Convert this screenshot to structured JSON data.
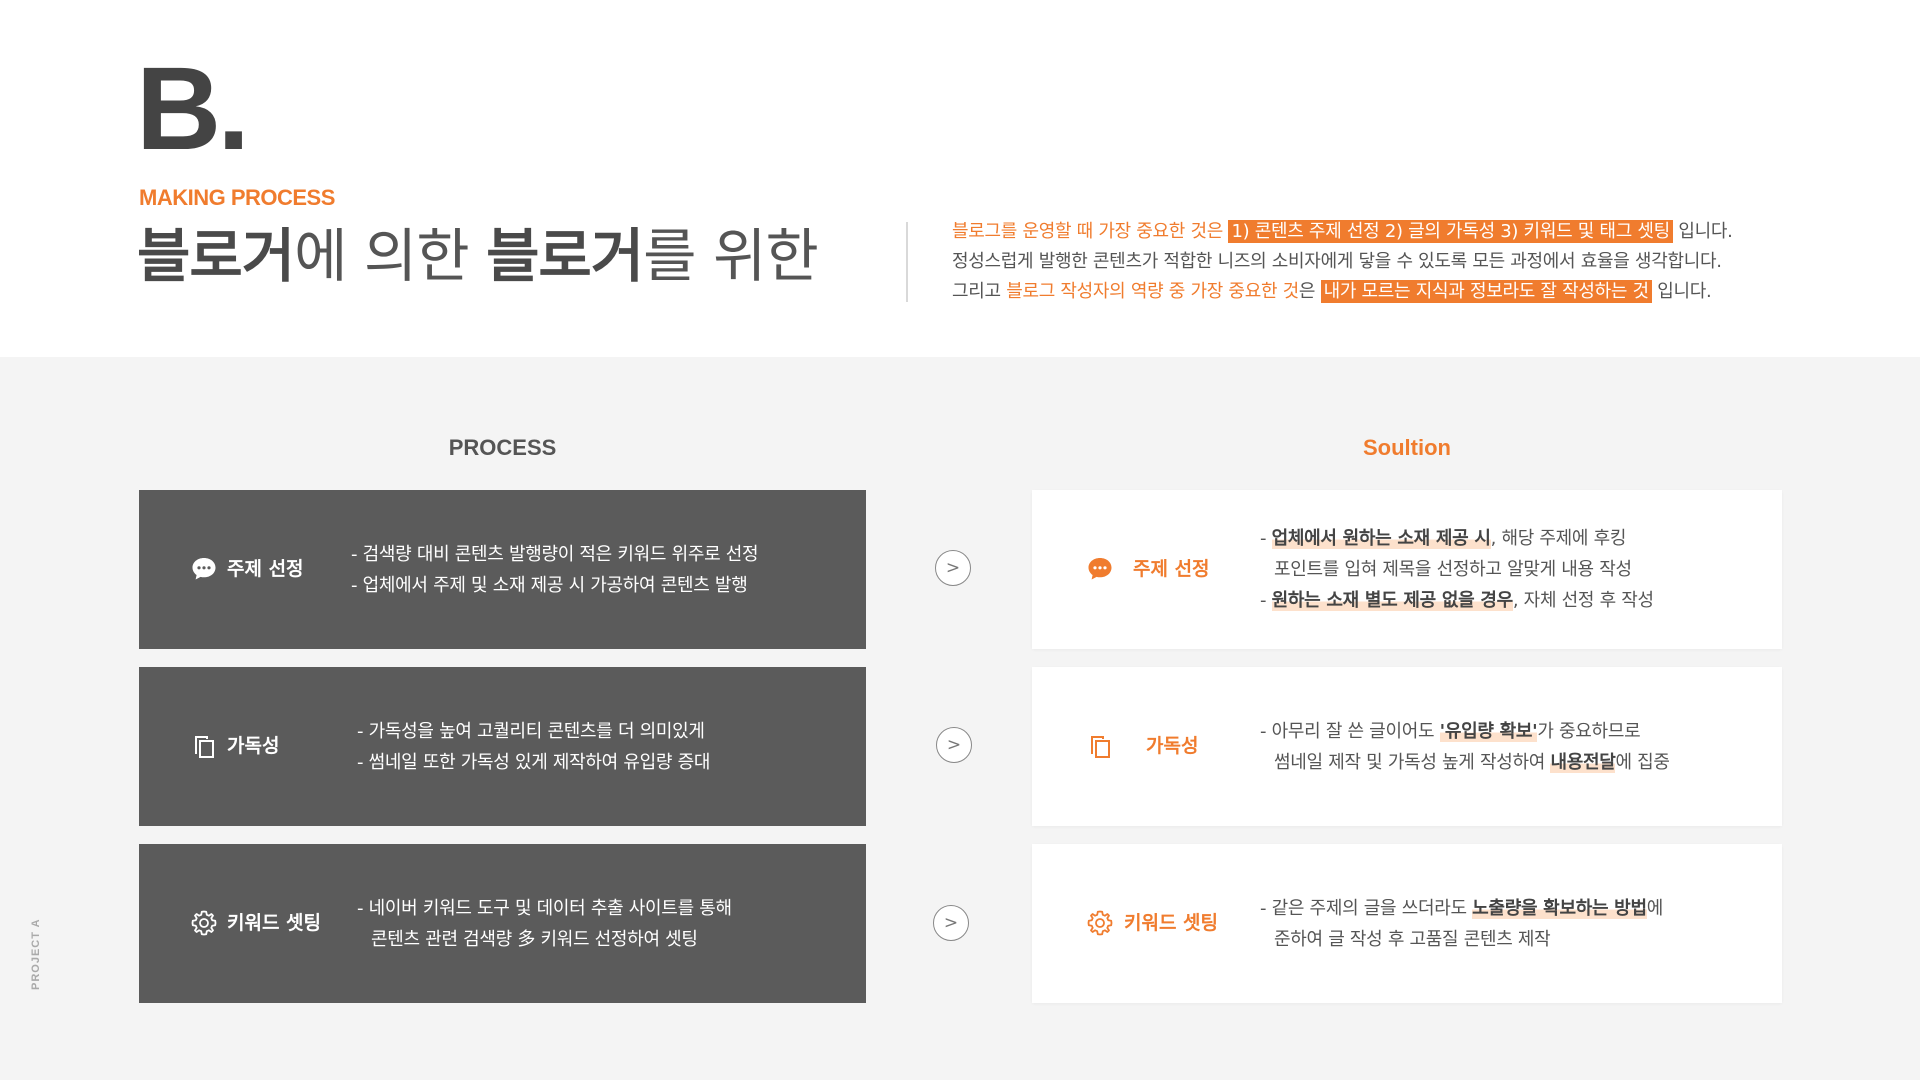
{
  "header": {
    "letter": "B.",
    "subtitle": "MAKING PROCESS",
    "headline": {
      "part1": "블로거",
      "part2": "에 의한 ",
      "part3": "블로거",
      "part4": "를 위한"
    }
  },
  "intro": {
    "line1": {
      "orange": "블로그를 운영할 때 가장 중요한 것은",
      "highlight": "1) 콘텐츠 주제 선정 2) 글의 가독성 3) 키워드 및 태그 셋팅",
      "tail": "입니다."
    },
    "line2": "정성스럽게 발행한 콘텐츠가 적합한 니즈의 소비자에게 닿을 수 있도록 모든 과정에서 효율을 생각합니다.",
    "line3": {
      "pre": "그리고",
      "orange": "블로그 작성자의 역량 중 가장 중요한 것",
      "mid": "은",
      "highlight": "내가 모르는 지식과 정보라도 잘 작성하는 것",
      "tail": "입니다."
    }
  },
  "process": {
    "heading": "PROCESS",
    "items": [
      {
        "icon": "chat-bubble-icon",
        "title": "주제 선정",
        "lines": [
          "- 검색량 대비 콘텐츠 발행량이 적은 키워드 위주로 선정",
          "- 업체에서 주제 및 소재 제공 시 가공하여 콘텐츠 발행"
        ]
      },
      {
        "icon": "copy-icon",
        "title": "가독성",
        "lines": [
          "- 가독성을 높여 고퀄리티 콘텐츠를 더 의미있게",
          "- 썸네일 또한 가독성 있게 제작하여 유입량 증대"
        ]
      },
      {
        "icon": "gear-icon",
        "title": "키워드 셋팅",
        "lines": [
          "- 네이버 키워드 도구 및 데이터 추출 사이트를 통해",
          "콘텐츠 관련 검색량 多 키워드 선정하여 셋팅"
        ]
      }
    ]
  },
  "arrow_glyph": ">",
  "solution": {
    "heading": "Soultion",
    "items": [
      {
        "icon": "chat-bubble-icon",
        "title": "주제 선정",
        "l1_dash": "- ",
        "l1_mark": "업체에서 원하는 소재 제공 시",
        "l1_tail": ", 해당 주제에 후킹",
        "l2": "포인트를 입혀 제목을 선정하고 알맞게 내용 작성",
        "l3_dash": "- ",
        "l3_mark": "원하는 소재 별도 제공 없을 경우",
        "l3_tail": ", 자체 선정 후 작성"
      },
      {
        "icon": "copy-icon",
        "title": "가독성",
        "l1_pre": "- 아무리 잘 쓴 글이어도 ",
        "l1_mark": "'유입량 확보'",
        "l1_tail": "가 중요하므로",
        "l2_pre": "썸네일 제작 및 가독성 높게 작성하여 ",
        "l2_mark": "내용전달",
        "l2_tail": "에 집중"
      },
      {
        "icon": "gear-icon",
        "title": "키워드 셋팅",
        "l1_pre": "- 같은 주제의 글을 쓰더라도 ",
        "l1_mark": "노출량을 확보하는 방법",
        "l1_tail": "에",
        "l2": "준하여 글 작성 후 고품질 콘텐츠 제작"
      }
    ]
  },
  "side_label": "PROJECT A",
  "colors": {
    "accent": "#f07c2e",
    "dark_card": "#5b5b5b",
    "text": "#555555"
  }
}
